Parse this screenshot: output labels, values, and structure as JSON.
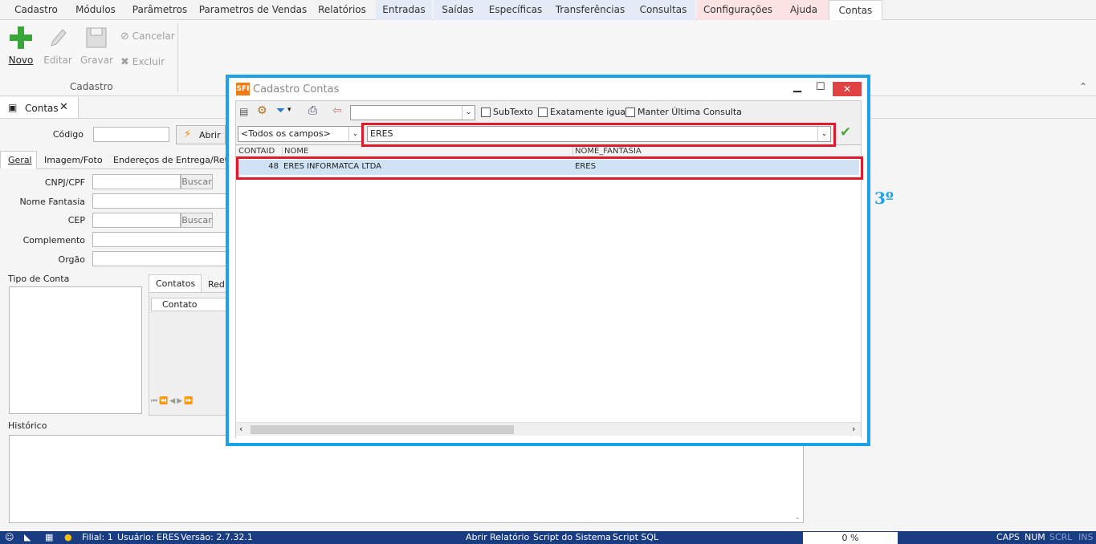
{
  "ribbon": {
    "tabs": [
      "Cadastro",
      "Módulos",
      "Parâmetros",
      "Parametros de Vendas",
      "Relatórios",
      "Entradas",
      "Saídas",
      "Específicas",
      "Transferências",
      "Consultas",
      "Configurações",
      "Ajuda",
      "Contas"
    ],
    "buttons": {
      "novo": "Novo",
      "editar": "Editar",
      "gravar": "Gravar",
      "cancelar": "Cancelar",
      "excluir": "Excluir"
    },
    "group_label": "Cadastro"
  },
  "doc_tab": {
    "label": "Contas"
  },
  "form": {
    "codigo_label": "Código",
    "abrir_label": "Abrir",
    "tabs": [
      "Geral",
      "Imagem/Foto",
      "Endereços de Entrega/Retir"
    ],
    "cnpj_label": "CNPJ/CPF",
    "buscar_label": "Buscar",
    "nome_fantasia_label": "Nome Fantasia",
    "cep_label": "CEP",
    "complemento_label": "Complemento",
    "orgao_label": "Orgão",
    "tipo_conta_label": "Tipo de Conta",
    "sub_tabs": [
      "Contatos",
      "Red"
    ],
    "contato_col": "Contato",
    "historico_label": "Histórico"
  },
  "dialog": {
    "title": "Cadastro Contas",
    "subtexto": "SubTexto",
    "exatamente_igual": "Exatamente igual",
    "manter_ultima": "Manter Última Consulta",
    "field_select": "<Todos os campos>",
    "search_value": "ERES",
    "columns": [
      "CONTAID",
      "NOME",
      "NOME_FANTASIA"
    ],
    "rows": [
      {
        "id": "48",
        "nome": "ERES INFORMATCA LTDA",
        "fantasia": "ERES"
      }
    ]
  },
  "annotation": "3º",
  "status": {
    "filial": "Filial: 1",
    "usuario": "Usuário: ERES",
    "versao": "Versão: 2.7.32.1",
    "abrir_relatorio": "Abrir Relatório",
    "script_sistema": "Script do Sistema",
    "script_sql": "Script SQL",
    "progress": "0 %",
    "caps": "CAPS",
    "num": "NUM",
    "scrl": "SCRL",
    "ins": "INS"
  },
  "colors": {
    "status_bar": "#1a3c82",
    "dialog_outline": "#1aa3e8",
    "highlight": "#e0192b",
    "selected_row": "#cfe3f5"
  }
}
